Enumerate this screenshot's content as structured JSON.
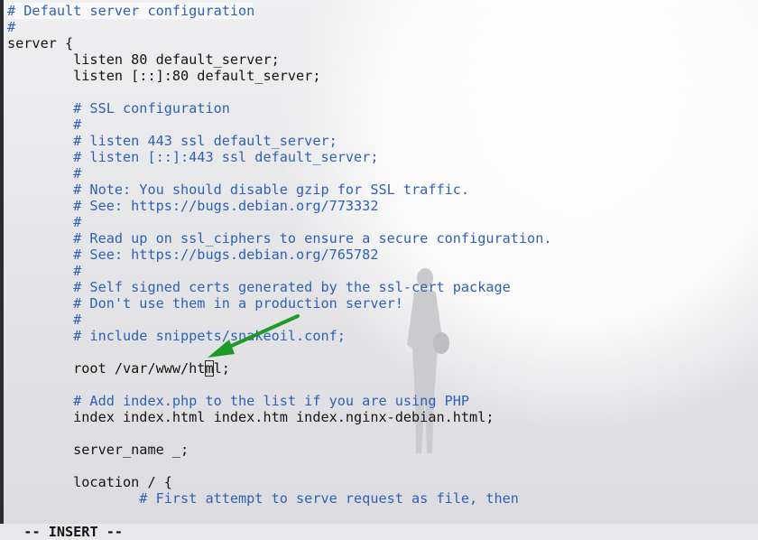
{
  "editor": {
    "lines": [
      {
        "type": "comment",
        "text": "# Default server configuration"
      },
      {
        "type": "comment",
        "text": "#"
      },
      {
        "type": "code",
        "text": "server {"
      },
      {
        "type": "code",
        "text": "        listen 80 default_server;"
      },
      {
        "type": "code",
        "text": "        listen [::]:80 default_server;"
      },
      {
        "type": "code",
        "text": ""
      },
      {
        "type": "comment",
        "text": "        # SSL configuration"
      },
      {
        "type": "comment",
        "text": "        #"
      },
      {
        "type": "comment",
        "text": "        # listen 443 ssl default_server;"
      },
      {
        "type": "comment",
        "text": "        # listen [::]:443 ssl default_server;"
      },
      {
        "type": "comment",
        "text": "        #"
      },
      {
        "type": "comment",
        "text": "        # Note: You should disable gzip for SSL traffic."
      },
      {
        "type": "comment",
        "text": "        # See: https://bugs.debian.org/773332"
      },
      {
        "type": "comment",
        "text": "        #"
      },
      {
        "type": "comment",
        "text": "        # Read up on ssl_ciphers to ensure a secure configuration."
      },
      {
        "type": "comment",
        "text": "        # See: https://bugs.debian.org/765782"
      },
      {
        "type": "comment",
        "text": "        #"
      },
      {
        "type": "comment",
        "text": "        # Self signed certs generated by the ssl-cert package"
      },
      {
        "type": "comment",
        "text": "        # Don't use them in a production server!"
      },
      {
        "type": "comment",
        "text": "        #"
      },
      {
        "type": "comment",
        "text": "        # include snippets/snakeoil.conf;"
      },
      {
        "type": "code",
        "text": ""
      },
      {
        "type": "cursor",
        "before": "        root /var/www/ht",
        "cursor": "m",
        "after": "l;"
      },
      {
        "type": "code",
        "text": ""
      },
      {
        "type": "comment",
        "text": "        # Add index.php to the list if you are using PHP"
      },
      {
        "type": "code",
        "text": "        index index.html index.htm index.nginx-debian.html;"
      },
      {
        "type": "code",
        "text": ""
      },
      {
        "type": "code",
        "text": "        server_name _;"
      },
      {
        "type": "code",
        "text": ""
      },
      {
        "type": "code",
        "text": "        location / {"
      },
      {
        "type": "comment",
        "text": "                # First attempt to serve request as file, then"
      }
    ]
  },
  "statusbar": {
    "mode": "-- INSERT --"
  },
  "colors": {
    "comment": "#2d62b7",
    "code": "#141414",
    "arrow": "#1e9a28"
  },
  "icons": {
    "annotation": "green-arrow-icon"
  }
}
